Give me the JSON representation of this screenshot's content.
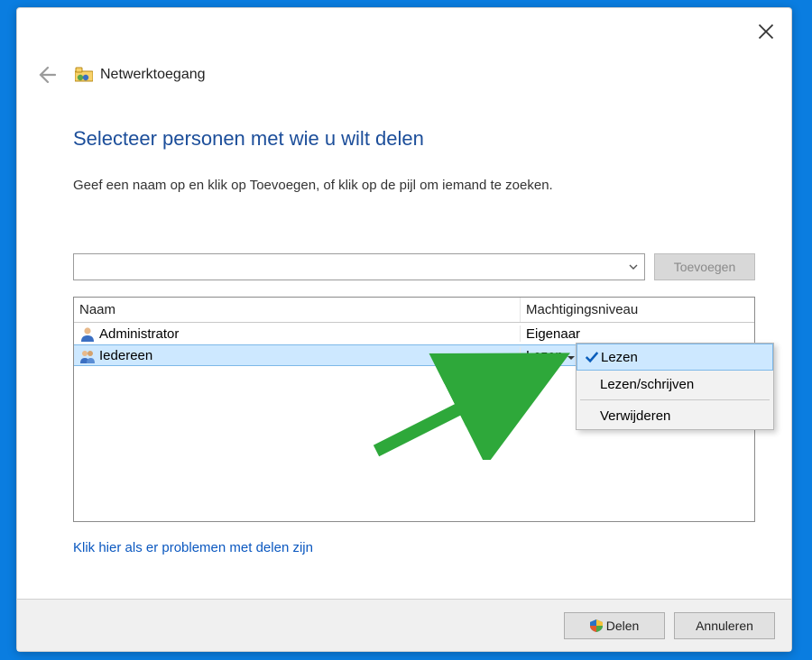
{
  "window": {
    "page_title": "Netwerktoegang"
  },
  "content": {
    "heading": "Selecteer personen met wie u wilt delen",
    "subtitle": "Geef een naam op en klik op Toevoegen, of klik op de pijl om iemand te zoeken.",
    "add_button": "Toevoegen",
    "help_link": "Klik hier als er problemen met delen zijn"
  },
  "table": {
    "col_name": "Naam",
    "col_perm": "Machtigingsniveau",
    "rows": [
      {
        "name": "Administrator",
        "perm": "Eigenaar",
        "type": "user",
        "selected": false
      },
      {
        "name": "Iedereen",
        "perm": "Lezen",
        "type": "group",
        "selected": true
      }
    ]
  },
  "menu": {
    "items": [
      {
        "label": "Lezen",
        "checked": true
      },
      {
        "label": "Lezen/schrijven",
        "checked": false
      }
    ],
    "sep_items": [
      {
        "label": "Verwijderen",
        "checked": false
      }
    ]
  },
  "footer": {
    "share": "Delen",
    "cancel": "Annuleren"
  }
}
